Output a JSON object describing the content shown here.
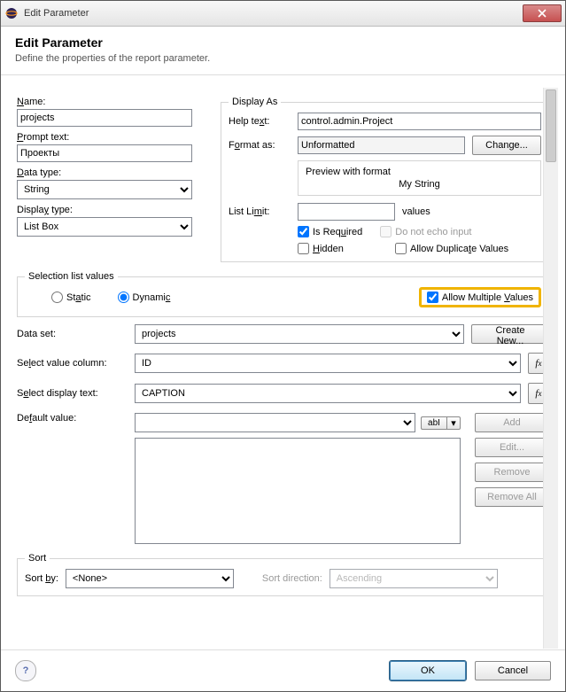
{
  "window": {
    "title": "Edit Parameter"
  },
  "header": {
    "heading": "Edit Parameter",
    "sub": "Define the properties of the report parameter."
  },
  "left": {
    "name_label": "Name:",
    "name_value": "projects",
    "prompt_label": "Prompt text:",
    "prompt_value": "Проекты",
    "datatype_label": "Data type:",
    "datatype_value": "String",
    "displaytype_label": "Display type:",
    "displaytype_value": "List Box"
  },
  "display": {
    "group": "Display As",
    "help_label": "Help text:",
    "help_value": "control.admin.Project",
    "format_label": "Format as:",
    "format_value": "Unformatted",
    "change_btn": "Change...",
    "preview_label": "Preview with format",
    "preview_value": "My String",
    "listlimit_label": "List Limit:",
    "listlimit_value": "",
    "listlimit_suffix": "values",
    "is_required": "Is Required",
    "do_not_echo": "Do not echo input",
    "hidden": "Hidden",
    "allow_dup": "Allow Duplicate Values"
  },
  "selection": {
    "group": "Selection list values",
    "static": "Static",
    "dynamic": "Dynamic",
    "allow_multi": "Allow Multiple Values"
  },
  "dataset": {
    "label": "Data set:",
    "value": "projects",
    "create_new": "Create New..."
  },
  "value_col": {
    "label": "Select value column:",
    "value": "ID"
  },
  "display_text": {
    "label": "Select display text:",
    "value": "CAPTION"
  },
  "default_value": {
    "label": "Default value:",
    "abl": "abI",
    "add": "Add",
    "edit": "Edit...",
    "remove": "Remove",
    "remove_all": "Remove All"
  },
  "sort": {
    "group": "Sort",
    "sortby_label": "Sort by:",
    "sortby_value": "<None>",
    "dir_label": "Sort direction:",
    "dir_value": "Ascending"
  },
  "footer": {
    "ok": "OK",
    "cancel": "Cancel"
  }
}
